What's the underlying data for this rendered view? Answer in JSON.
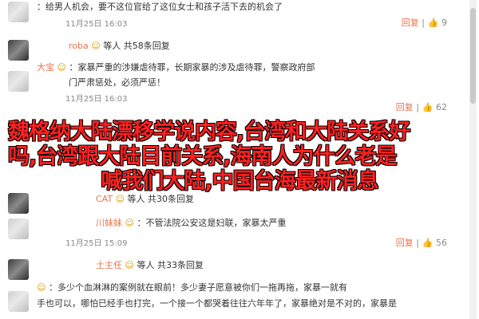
{
  "comments": [
    {
      "text": "：给男人机会，要不这位官给了这位女士和孩子活下去的机会了",
      "time": "11月25日 16:03",
      "reply": "回复",
      "likes": "9"
    },
    {
      "user": "roba",
      "text": "等人 共58条回复",
      "reply": ""
    },
    {
      "user": "大宝",
      "text": "：家暴严重的涉嫌虐待罪，长期家暴的涉及虐待罪，警察政府部",
      "text2": "门严肃惩处，必须严惩！",
      "time": "11月25日 16:03",
      "reply": "回复",
      "likes": "62"
    },
    {
      "user": "CAT",
      "text": "等人 共30条回复",
      "reply": ""
    },
    {
      "user": "川妹妹",
      "text": "：不管法院公安这是妇联，家暴太严重",
      "time": "11月25日 15:09",
      "reply": "回复",
      "likes": "56"
    },
    {
      "user": "土主任",
      "text": "等人 共33条回复",
      "reply": ""
    },
    {
      "user": "",
      "text": "：多少个血淋淋的案例就在眼前！多少妻子愿意被你们一拖再拖，家暴一就有",
      "text2": "手也可以，哪怕已经手也打完，一个接一个都哭着往往六年年了，家暴绝对是不对的，家暴是",
      "reply": ""
    }
  ],
  "overlay": {
    "line1": "魏格纳大陆漂移学说内容,台湾和大陆关系好",
    "line2": "吗,台湾跟大陆目前关系,海南人为什么老是",
    "line3": "喊我们大陆,中国台海最新消息"
  },
  "ui": {
    "thumb": "👍",
    "dot": "|"
  }
}
